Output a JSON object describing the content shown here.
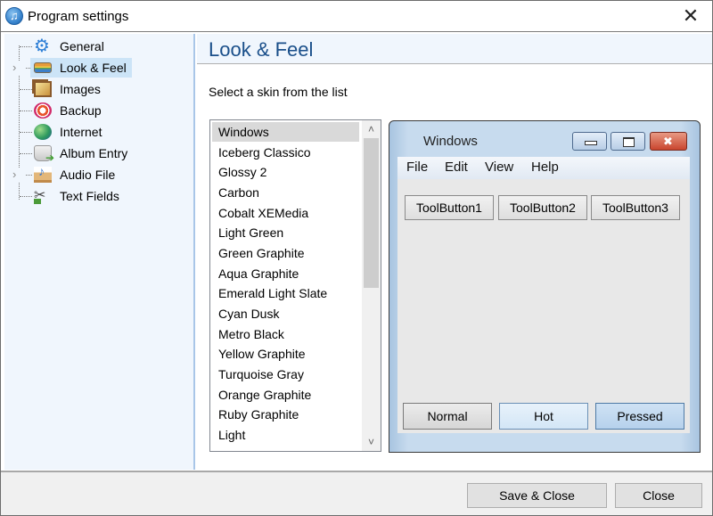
{
  "window": {
    "title": "Program settings",
    "close_icon": "close-icon"
  },
  "sidebar": {
    "items": [
      {
        "label": "General",
        "icon": "gear-icon",
        "expandable": false,
        "selected": false
      },
      {
        "label": "Look & Feel",
        "icon": "look-and-feel-icon",
        "expandable": true,
        "selected": true
      },
      {
        "label": "Images",
        "icon": "images-icon",
        "expandable": false,
        "selected": false
      },
      {
        "label": "Backup",
        "icon": "backup-icon",
        "expandable": false,
        "selected": false
      },
      {
        "label": "Internet",
        "icon": "internet-icon",
        "expandable": false,
        "selected": false
      },
      {
        "label": "Album Entry",
        "icon": "album-entry-icon",
        "expandable": false,
        "selected": false
      },
      {
        "label": "Audio File",
        "icon": "audio-file-icon",
        "expandable": true,
        "selected": false
      },
      {
        "label": "Text Fields",
        "icon": "text-fields-icon",
        "expandable": false,
        "selected": false
      }
    ]
  },
  "panel": {
    "title": "Look & Feel",
    "instruction": "Select a skin from the list"
  },
  "skins": {
    "selected": "Windows",
    "items": [
      "Windows",
      "Iceberg Classico",
      "Glossy 2",
      "Carbon",
      "Cobalt XEMedia",
      "Light Green",
      "Green Graphite",
      "Aqua Graphite",
      "Emerald Light Slate",
      "Cyan Dusk",
      "Metro Black",
      "Yellow Graphite",
      "Turquoise Gray",
      "Orange Graphite",
      "Ruby Graphite",
      "Light"
    ]
  },
  "preview": {
    "title": "Windows",
    "menu": [
      "File",
      "Edit",
      "View",
      "Help"
    ],
    "tool_buttons": [
      "ToolButton1",
      "ToolButton2",
      "ToolButton3"
    ],
    "state_buttons": [
      "Normal",
      "Hot",
      "Pressed"
    ]
  },
  "footer": {
    "save_close_label": "Save & Close",
    "close_label": "Close"
  },
  "colors": {
    "accent_title": "#1a4f8a",
    "sidebar_bg": "#f0f6fd",
    "selection": "#cce4f7"
  }
}
